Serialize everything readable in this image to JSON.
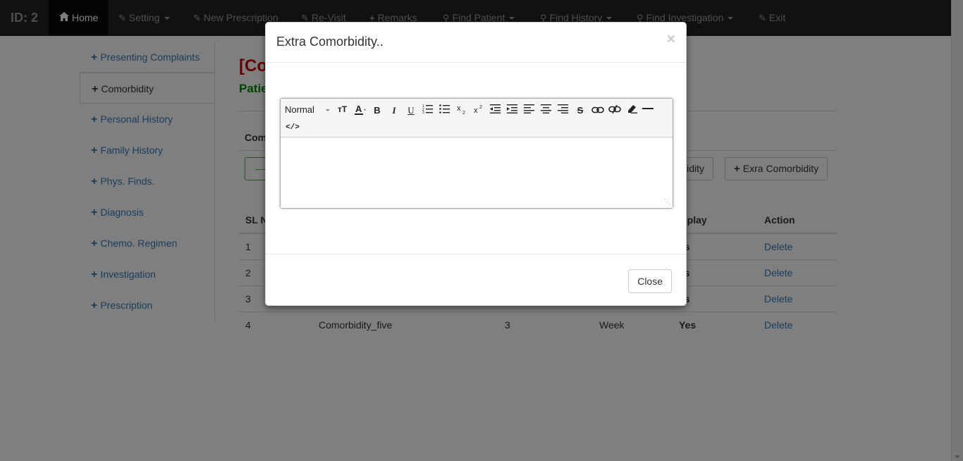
{
  "navbar": {
    "brand": "ID: 2",
    "items": [
      {
        "label": "Home",
        "icon": "home-icon"
      },
      {
        "label": "Setting",
        "icon": "edit-icon"
      },
      {
        "label": "New Prescription",
        "icon": "edit-icon"
      },
      {
        "label": "Re-Visit",
        "icon": "edit-icon"
      },
      {
        "label": "Remarks",
        "icon": "plus-icon"
      },
      {
        "label": "Find Patient",
        "icon": "search-icon"
      },
      {
        "label": "Find History",
        "icon": "search-icon"
      },
      {
        "label": "Find Investigation",
        "icon": "search-icon"
      },
      {
        "label": "Exit",
        "icon": "edit-icon"
      }
    ]
  },
  "sidebar": {
    "items": [
      {
        "label": "Presenting Complaints"
      },
      {
        "label": "Comorbidity"
      },
      {
        "label": "Personal History"
      },
      {
        "label": "Family History"
      },
      {
        "label": "Phys. Finds."
      },
      {
        "label": "Diagnosis"
      },
      {
        "label": "Chemo. Regimen"
      },
      {
        "label": "Investigation"
      },
      {
        "label": "Prescription"
      }
    ]
  },
  "main": {
    "title": "[Co",
    "subtitle": "Patie",
    "tab_label": "Com",
    "green_button": "—",
    "button_comorbidity": "idity",
    "button_extra": "Exra Comorbidity",
    "table": {
      "headers": [
        "SL N",
        "",
        "",
        "",
        "isplay",
        "Action"
      ],
      "rows": [
        {
          "sl": "1",
          "name": "",
          "num": "",
          "unit": "",
          "display": "es",
          "action": "Delete"
        },
        {
          "sl": "2",
          "name": "",
          "num": "",
          "unit": "",
          "display": "es",
          "action": "Delete"
        },
        {
          "sl": "3",
          "name": "",
          "num": "",
          "unit": "",
          "display": "es",
          "action": "Delete"
        },
        {
          "sl": "4",
          "name": "Comorbidity_five",
          "num": "3",
          "unit": "Week",
          "display": "Yes",
          "action": "Delete"
        }
      ]
    }
  },
  "modal": {
    "title": "Extra Comorbidity..",
    "close_x": "×",
    "close_button": "Close",
    "editor": {
      "format_select": "Normal",
      "content": ""
    }
  }
}
